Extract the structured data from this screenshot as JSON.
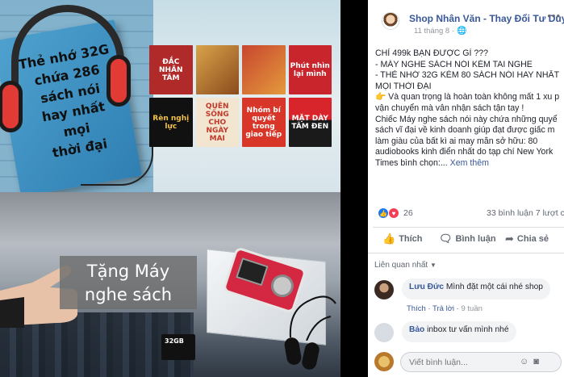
{
  "promo": {
    "book_text": [
      "Thẻ nhớ 32G",
      "chứa 286",
      "sách nói",
      "hay nhất",
      "mọi",
      "thời đại"
    ],
    "covers": [
      {
        "text": "ĐẮC NHÂN TÂM",
        "bg": "#b02a2a"
      },
      {
        "text": "",
        "bg": "#d9a34a"
      },
      {
        "text": "",
        "bg": "#c9462f"
      },
      {
        "text": "Phút nhìn lại mình",
        "bg": "#c8262c"
      },
      {
        "text": "Rèn nghị lực",
        "bg": "#111111"
      },
      {
        "text": "QUÊN SỐNG CHO NGÀY MAI",
        "bg": "#f2e6d0"
      },
      {
        "text": "Nhóm bí quyết trong giao tiếp",
        "bg": "#d9362a"
      },
      {
        "text": "MẶT DÀY TÂM ĐEN",
        "bg": "#1a1a1a"
      }
    ],
    "gift_line_1": "Tặng Máy",
    "gift_line_2": "nghe sách",
    "sd_label": "32GB"
  },
  "post": {
    "page_name": "Shop Nhân Văn - Thay Đổi Tư Duy",
    "date": "11 tháng 8 ·",
    "lines": [
      "CHỈ 499k BẠN ĐƯỢC GÌ ???",
      "- MÁY NGHE SÁCH NÓI KÈM TAI NGHE",
      "- THẺ NHỚ 32G KÈM 80 SÁCH NÓI HAY NHẤT",
      "MỌI THỜI ĐẠI",
      "👉 Và quan trọng là hoàn toàn không mất 1 xu p",
      "vận chuyển mà vẫn nhận sách tận tay !",
      "Chiếc Máy nghe sách nói này chứa những quyể",
      "sách vĩ đại về kinh doanh giúp đạt được giấc m",
      "làm giàu của bất kì ai may mắn sở hữu: 80",
      "audiobooks kinh điển nhất do tạp chí New York",
      "Times bình chọn:..."
    ],
    "see_more": "Xem thêm",
    "reaction_count": "26",
    "comment_count": "33 bình luận   7 lượt c",
    "actions": {
      "like": "Thích",
      "comment": "Bình luận",
      "share": "Chia sẻ"
    },
    "sort_label": "Liên quan nhất"
  },
  "comments": [
    {
      "name": "Lưu Đức",
      "text": "Mình đặt một cái nhé shop",
      "like": "Thích",
      "reply": "Trả lời",
      "time": "9 tuần"
    },
    {
      "name": "Bảo",
      "text": "inbox tư vấn mình nhé"
    }
  ],
  "composer": {
    "placeholder": "Viết bình luận..."
  }
}
